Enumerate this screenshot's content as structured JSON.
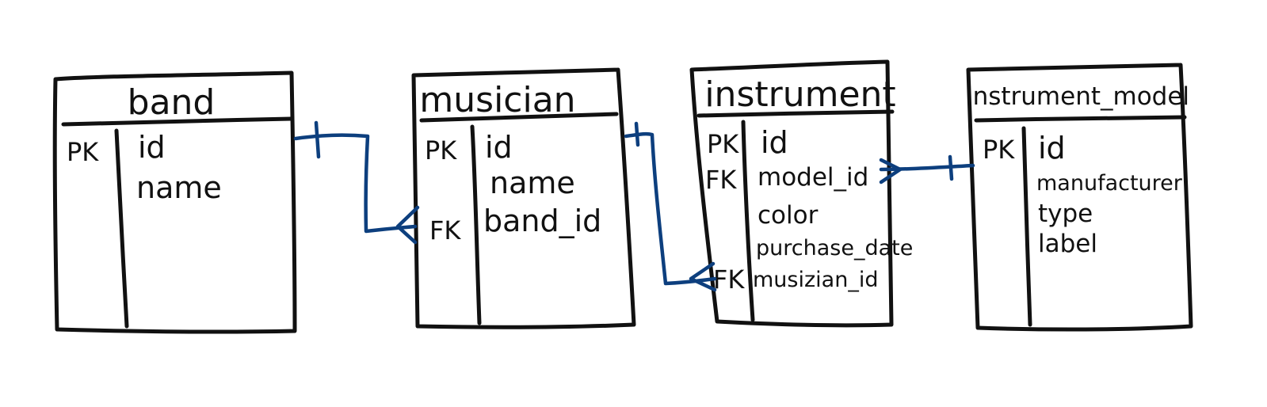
{
  "tables": [
    {
      "id": "band",
      "title": "band",
      "rows": [
        {
          "key": "PK",
          "field": "id"
        },
        {
          "key": "",
          "field": "name"
        }
      ]
    },
    {
      "id": "musician",
      "title": "musician",
      "rows": [
        {
          "key": "PK",
          "field": "id"
        },
        {
          "key": "",
          "field": "name"
        },
        {
          "key": "FK",
          "field": "band_id"
        }
      ]
    },
    {
      "id": "instrument",
      "title": "instrument",
      "rows": [
        {
          "key": "PK",
          "field": "id"
        },
        {
          "key": "FK",
          "field": "model_id"
        },
        {
          "key": "",
          "field": "color"
        },
        {
          "key": "",
          "field": "purchase_date"
        },
        {
          "key": "FK",
          "field": "musizian_id"
        }
      ]
    },
    {
      "id": "instrument_model",
      "title": "instrument_model",
      "rows": [
        {
          "key": "PK",
          "field": "id"
        },
        {
          "key": "",
          "field": "manufacturer"
        },
        {
          "key": "",
          "field": "type"
        },
        {
          "key": "",
          "field": "label"
        }
      ]
    }
  ],
  "relationships": [
    {
      "from": "band.id",
      "to": "musician.band_id",
      "from_end": "one",
      "to_end": "many"
    },
    {
      "from": "musician.id",
      "to": "instrument.musizian_id",
      "from_end": "one",
      "to_end": "many"
    },
    {
      "from": "instrument.model_id",
      "to": "instrument_model.id",
      "from_end": "many",
      "to_end": "one"
    }
  ],
  "colors": {
    "ink": "#111111",
    "relationship": "#0d3f7e",
    "background": "#ffffff"
  }
}
